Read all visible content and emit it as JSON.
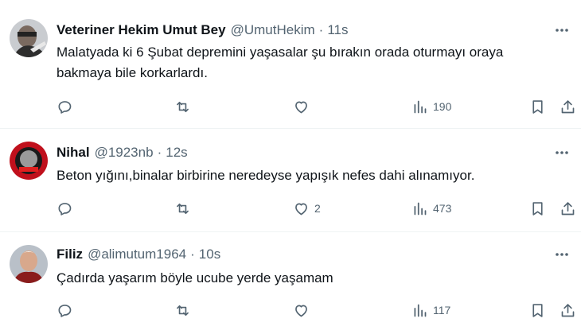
{
  "tweets": [
    {
      "name": "Veteriner Hekim Umut Bey",
      "handle": "@UmutHekim",
      "separator": "·",
      "time": "11s",
      "text": "Malatyada ki 6 Şubat depremini yaşasalar şu bırakın orada oturmayı oraya bakmaya bile korkarlardı.",
      "likes": "",
      "views": "190"
    },
    {
      "name": "Nihal",
      "handle": "@1923nb",
      "separator": "·",
      "time": "12s",
      "text": "Beton yığını,binalar birbirine neredeyse yapışık nefes dahi alınamıyor.",
      "likes": "2",
      "views": "473"
    },
    {
      "name": "Filiz",
      "handle": "@alimutum1964",
      "separator": "·",
      "time": "10s",
      "text": "Çadırda yaşarım böyle ucube yerde yaşamam",
      "likes": "",
      "views": "117"
    }
  ],
  "icons": {
    "more": "more-horizontal-icon",
    "reply": "reply-icon",
    "retweet": "retweet-icon",
    "like": "heart-icon",
    "views": "views-bar-icon",
    "bookmark": "bookmark-icon",
    "share": "share-icon"
  },
  "colors": {
    "text": "#0f1419",
    "secondary": "#536471",
    "divider": "#eff3f4"
  }
}
